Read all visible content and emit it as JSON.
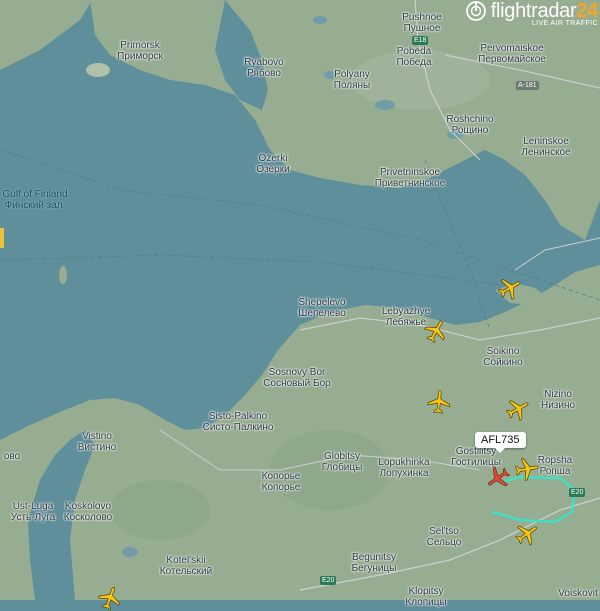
{
  "app": {
    "brand_name": "flightradar",
    "brand_number": "24",
    "tagline": "LIVE AIR TRAFFIC"
  },
  "colors": {
    "water": "#5f8f9a",
    "land": "#96ad91",
    "forest": "#8aa588",
    "road": "#c9cfcd",
    "track": "#3fe0c6",
    "aircraft": "#f5c518",
    "selected_aircraft": "#e8433c",
    "left_strip": "#e8c43a"
  },
  "labels": [
    {
      "id": "primorsk",
      "lines": [
        "Primorsk",
        "Приморск"
      ]
    },
    {
      "id": "ryabovo",
      "lines": [
        "Ryabovo",
        "Рябово"
      ]
    },
    {
      "id": "polyany",
      "lines": [
        "Polyany",
        "Поляны"
      ]
    },
    {
      "id": "pushnoe",
      "lines": [
        "Pushnoe",
        "Пушное"
      ]
    },
    {
      "id": "pobeda",
      "lines": [
        "Pobeda",
        "Победа"
      ]
    },
    {
      "id": "pervomaiskoe",
      "lines": [
        "Pervomaiskoe",
        "Первомайское"
      ]
    },
    {
      "id": "roshchino",
      "lines": [
        "Roshchino",
        "Рощино"
      ]
    },
    {
      "id": "leninskoe",
      "lines": [
        "Leninskoe",
        "Ленинское"
      ]
    },
    {
      "id": "ozerki",
      "lines": [
        "Ozerki",
        "Озерки"
      ]
    },
    {
      "id": "privetninskoe",
      "lines": [
        "Privetninskoe",
        "Приветнинское"
      ]
    },
    {
      "id": "gulf",
      "lines": [
        "Gulf of Finland",
        "Финский зал."
      ],
      "water": true
    },
    {
      "id": "shepelevo",
      "lines": [
        "Shepelevo",
        "Шепелево"
      ]
    },
    {
      "id": "lebyazhye",
      "lines": [
        "Lebyazhye",
        "Лебяжье"
      ]
    },
    {
      "id": "soikino",
      "lines": [
        "Soikino",
        "Сойкино"
      ]
    },
    {
      "id": "sosnovy-bor",
      "lines": [
        "Sosnovy Bor",
        "Сосновый Бор"
      ]
    },
    {
      "id": "nizino",
      "lines": [
        "Nizino",
        "Низино"
      ]
    },
    {
      "id": "sisto-palkino",
      "lines": [
        "Sisto-Palkino",
        "Систо-Палкино"
      ]
    },
    {
      "id": "vistino",
      "lines": [
        "Vistino",
        "Вистино"
      ]
    },
    {
      "id": "lopukhinka",
      "lines": [
        "Lopukhinka",
        "Лопухинка"
      ]
    },
    {
      "id": "globitsy",
      "lines": [
        "Globitsy",
        "Глобицы"
      ]
    },
    {
      "id": "gostilitsy",
      "lines": [
        "Gostilitsy",
        "Гостилицы"
      ]
    },
    {
      "id": "ropsha",
      "lines": [
        "Ropsha",
        "Ропша"
      ]
    },
    {
      "id": "koporye",
      "lines": [
        "Копорье",
        "Копорье"
      ]
    },
    {
      "id": "ust-luga",
      "lines": [
        "Ust-Luga",
        "Усть-Луга"
      ]
    },
    {
      "id": "koskolovo",
      "lines": [
        "Koskolovo",
        "Косколово"
      ]
    },
    {
      "id": "seltso",
      "lines": [
        "Sel'tso",
        "Сельцо"
      ]
    },
    {
      "id": "kotelskii",
      "lines": [
        "Kotel'skii",
        "Котельский"
      ]
    },
    {
      "id": "begunitsy",
      "lines": [
        "Begunitsy",
        "Бегуницы"
      ]
    },
    {
      "id": "klopitsy",
      "lines": [
        "Klopitsy",
        "Клопицы"
      ]
    },
    {
      "id": "voiskovitsy",
      "lines": [
        "Voiskovit"
      ]
    },
    {
      "id": "ovo",
      "lines": [
        "ово"
      ]
    }
  ],
  "roads": [
    {
      "id": "e18",
      "text": "E18"
    },
    {
      "id": "a181",
      "text": "A-181"
    },
    {
      "id": "e20a",
      "text": "E20"
    },
    {
      "id": "e20b",
      "text": "E20"
    }
  ],
  "aircraft": [
    {
      "id": "plane-kronstadt",
      "heading": 60
    },
    {
      "id": "plane-lebyazhye",
      "heading": 30
    },
    {
      "id": "plane-mid",
      "heading": 5
    },
    {
      "id": "plane-nizino",
      "heading": 60
    },
    {
      "id": "plane-ropsha",
      "heading": 80
    },
    {
      "id": "plane-south",
      "heading": 55
    },
    {
      "id": "plane-bottom-left",
      "heading": 20
    },
    {
      "id": "plane-selected",
      "heading": 235,
      "selected": true,
      "callsign": "AFL735"
    }
  ]
}
